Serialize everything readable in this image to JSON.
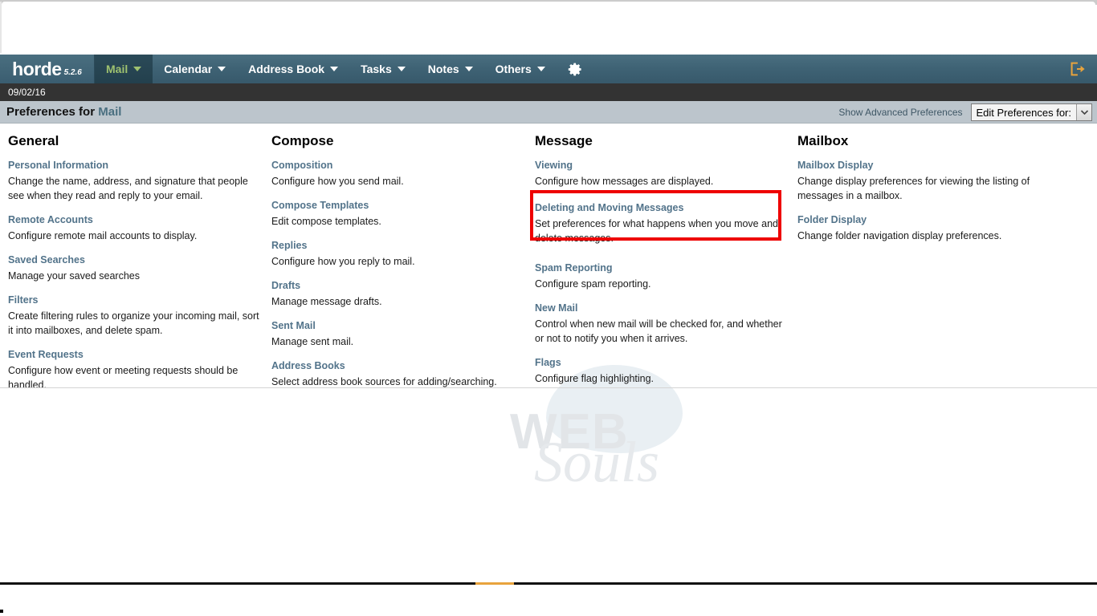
{
  "nav": {
    "logo": {
      "wordmark": "horde",
      "version": "5.2.6"
    },
    "items": [
      {
        "label": "Mail",
        "active": true
      },
      {
        "label": "Calendar",
        "active": false
      },
      {
        "label": "Address Book",
        "active": false
      },
      {
        "label": "Tasks",
        "active": false
      },
      {
        "label": "Notes",
        "active": false
      },
      {
        "label": "Others",
        "active": false
      }
    ],
    "gear_icon": "gear-icon",
    "logout_icon": "logout-icon",
    "active_color": "#9ec16f",
    "bar_color": "#3f6375"
  },
  "date_bar": {
    "date": "09/02/16"
  },
  "prefs_header": {
    "title_prefix": "Preferences for ",
    "title_app": "Mail",
    "show_advanced": "Show Advanced Preferences",
    "select_label": "Edit Preferences for:",
    "select_caret": "chevron-down-icon"
  },
  "columns": [
    {
      "title": "General",
      "groups": [
        {
          "link": "Personal Information",
          "desc": "Change the name, address, and signature that people see when they read and reply to your email."
        },
        {
          "link": "Remote Accounts",
          "desc": "Configure remote mail accounts to display."
        },
        {
          "link": "Saved Searches",
          "desc": "Manage your saved searches"
        },
        {
          "link": "Filters",
          "desc": "Create filtering rules to organize your incoming mail, sort it into mailboxes, and delete spam."
        },
        {
          "link": "Event Requests",
          "desc": "Configure how event or meeting requests should be handled."
        }
      ]
    },
    {
      "title": "Compose",
      "groups": [
        {
          "link": "Composition",
          "desc": "Configure how you send mail."
        },
        {
          "link": "Compose Templates",
          "desc": "Edit compose templates."
        },
        {
          "link": "Replies",
          "desc": "Configure how you reply to mail."
        },
        {
          "link": "Drafts",
          "desc": "Manage message drafts."
        },
        {
          "link": "Sent Mail",
          "desc": "Manage sent mail."
        },
        {
          "link": "Address Books",
          "desc": "Select address book sources for adding/searching."
        }
      ]
    },
    {
      "title": "Message",
      "groups": [
        {
          "link": "Viewing",
          "desc": "Configure how messages are displayed."
        },
        {
          "link": "Deleting and Moving Messages",
          "desc": "Set preferences for what happens when you move and delete messages."
        },
        {
          "link": "Spam Reporting",
          "desc": "Configure spam reporting."
        },
        {
          "link": "New Mail",
          "desc": "Control when new mail will be checked for, and whether or not to notify you when it arrives."
        },
        {
          "link": "Flags",
          "desc": "Configure flag highlighting."
        }
      ]
    },
    {
      "title": "Mailbox",
      "groups": [
        {
          "link": "Mailbox Display",
          "desc": "Change display preferences for viewing the listing of messages in a mailbox."
        },
        {
          "link": "Folder Display",
          "desc": "Change folder navigation display preferences."
        }
      ]
    }
  ],
  "annotation": {
    "highlight_target": "Deleting and Moving Messages",
    "color": "#ee0000"
  },
  "watermark": {
    "line1": "WEB",
    "line2": "Souls"
  }
}
